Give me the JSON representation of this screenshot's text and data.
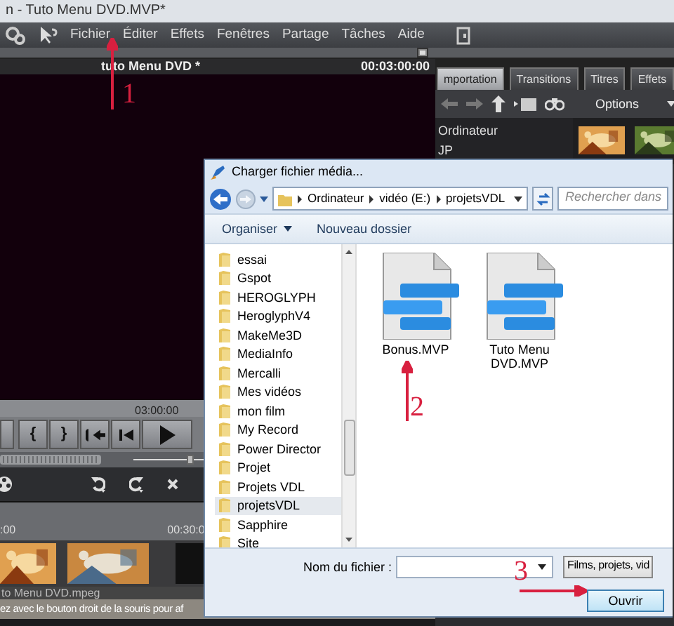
{
  "window": {
    "title": "n - Tuto Menu DVD.MVP*"
  },
  "menu": [
    "Fichier",
    "Éditer",
    "Effets",
    "Fenêtres",
    "Partage",
    "Tâches",
    "Aide"
  ],
  "preview": {
    "title": "tuto Menu DVD *",
    "duration": "00:03:00:00",
    "ruler_label": "03:00:00",
    "transport": [
      "{",
      "}"
    ],
    "zoom": {
      "level": 0.85
    }
  },
  "media_panel": {
    "tabs": [
      {
        "label": "mportation",
        "selected": true
      },
      {
        "label": "Transitions",
        "selected": false
      },
      {
        "label": "Titres",
        "selected": false
      },
      {
        "label": "Effets",
        "selected": false
      }
    ],
    "options": "Options",
    "locations": [
      "Ordinateur",
      "JP"
    ]
  },
  "timeline": {
    "ruler": [
      ":00",
      "00:30:0"
    ],
    "clip_name": "to Menu DVD.mpeg",
    "hint": "ez avec le bouton droit de la souris pour af"
  },
  "dialog": {
    "title": "Charger fichier média...",
    "path": [
      "Ordinateur",
      "vidéo (E:)",
      "projetsVDL"
    ],
    "search_placeholder": "Rechercher dans",
    "toolbar": [
      "Organiser",
      "Nouveau dossier"
    ],
    "folders": [
      {
        "label": "essai",
        "selected": false
      },
      {
        "label": "Gspot",
        "selected": false
      },
      {
        "label": "HEROGLYPH",
        "selected": false
      },
      {
        "label": "HeroglyphV4",
        "selected": false
      },
      {
        "label": "MakeMe3D",
        "selected": false
      },
      {
        "label": "MediaInfo",
        "selected": false
      },
      {
        "label": "Mercalli",
        "selected": false
      },
      {
        "label": "Mes vidéos",
        "selected": false
      },
      {
        "label": "mon film",
        "selected": false
      },
      {
        "label": "My Record",
        "selected": false
      },
      {
        "label": "Power Director",
        "selected": false
      },
      {
        "label": "Projet",
        "selected": false
      },
      {
        "label": "Projets VDL",
        "selected": false
      },
      {
        "label": "projetsVDL",
        "selected": true
      },
      {
        "label": "Sapphire",
        "selected": false
      },
      {
        "label": "Site",
        "selected": false
      }
    ],
    "files": [
      "Bonus.MVP",
      "Tuto Menu DVD.MVP"
    ],
    "filename_label": "Nom du fichier :",
    "file_type": "Films, projets, vid",
    "open_button": "Ouvrir"
  },
  "annotations": [
    "1",
    "2",
    "3"
  ]
}
